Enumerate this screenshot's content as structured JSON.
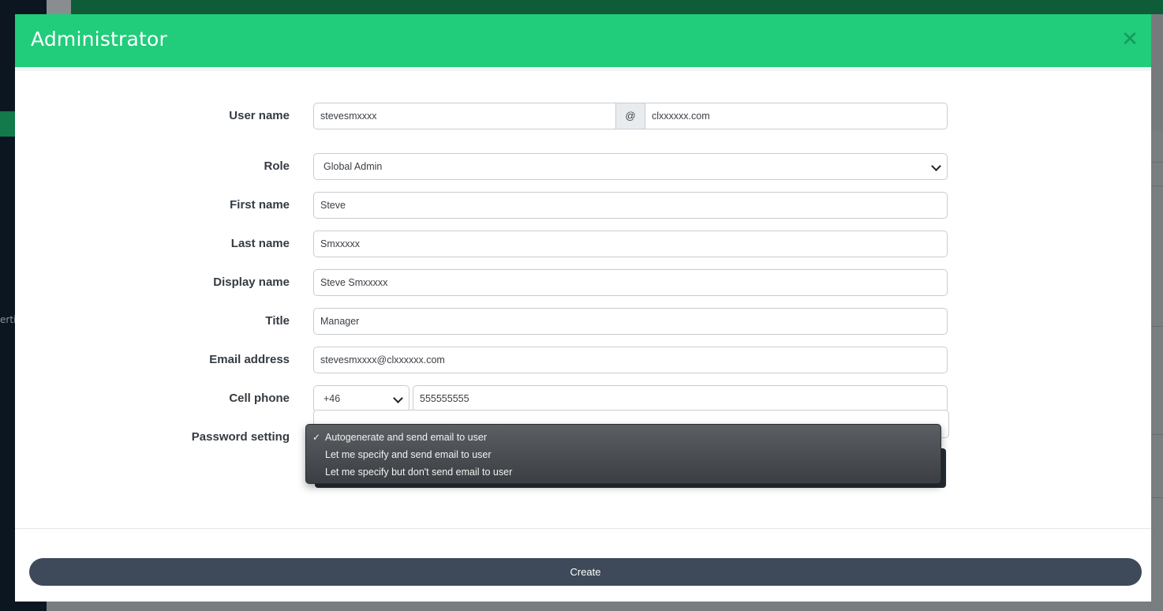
{
  "modal": {
    "title": "Administrator",
    "close_icon": "close-icon"
  },
  "form": {
    "username": {
      "label": "User name",
      "value": "stevesmxxxx",
      "at": "@",
      "domain": "clxxxxxx.com"
    },
    "role": {
      "label": "Role",
      "value": "Global Admin"
    },
    "first_name": {
      "label": "First name",
      "value": "Steve"
    },
    "last_name": {
      "label": "Last name",
      "value": "Smxxxxx"
    },
    "display_name": {
      "label": "Display name",
      "value": "Steve Smxxxxx"
    },
    "title": {
      "label": "Title",
      "value": "Manager"
    },
    "email": {
      "label": "Email address",
      "value": "stevesmxxxx@clxxxxxx.com"
    },
    "cell_phone": {
      "label": "Cell phone",
      "country_code": "+46",
      "number": "555555555"
    },
    "password_setting": {
      "label": "Password setting",
      "selected_index": 0,
      "options": [
        "Autogenerate and send email to user",
        "Let me specify and send email to user",
        "Let me specify but don't send email to user"
      ]
    }
  },
  "footer": {
    "create_label": "Create"
  },
  "background": {
    "sidebar_fragment": "erti"
  },
  "colors": {
    "header": "#21cc7a",
    "close": "#149a5c",
    "create_button": "#3e4a5a",
    "sidebar": "#0b1621"
  }
}
